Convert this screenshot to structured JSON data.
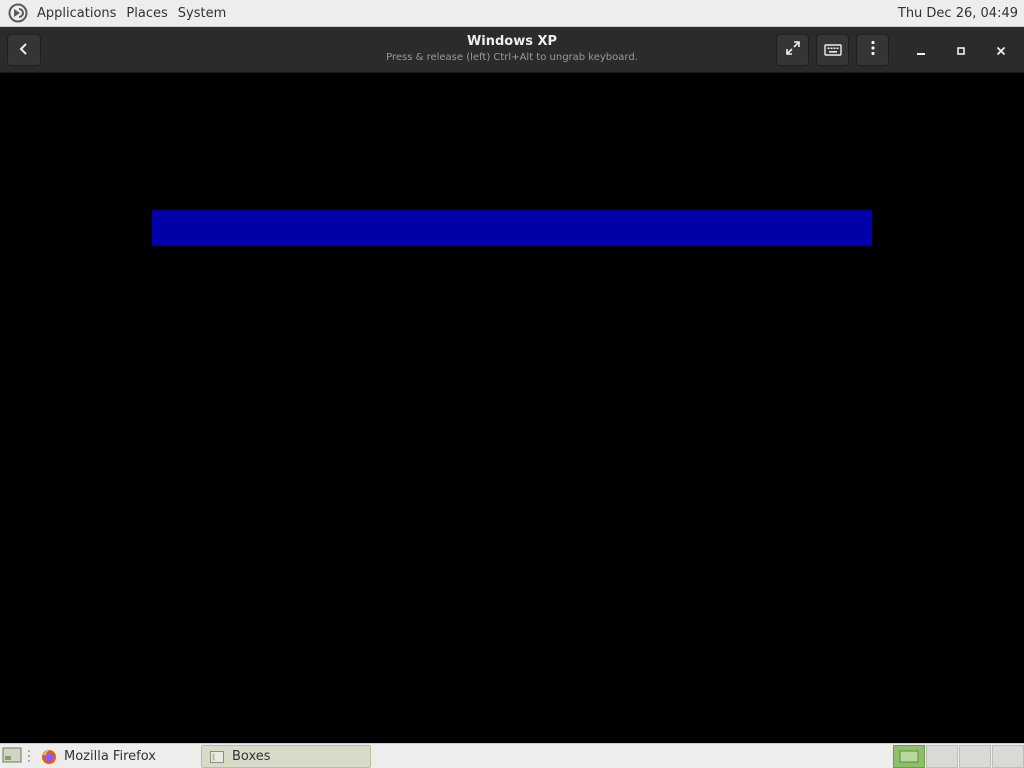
{
  "top_panel": {
    "menus": [
      "Applications",
      "Places",
      "System"
    ],
    "clock": "Thu Dec 26, 04:49",
    "logo_icon": "distro-logo-icon"
  },
  "headerbar": {
    "title": "Windows XP",
    "subtitle": "Press & release (left) Ctrl+Alt to ungrab keyboard.",
    "icons": {
      "back": "chevron-left-icon",
      "fullscreen": "fullscreen-icon",
      "keyboard": "keyboard-icon",
      "menu": "kebab-menu-icon",
      "minimize": "minimize-icon",
      "maximize": "maximize-icon",
      "close": "close-icon"
    }
  },
  "vm_display": {
    "bar_color": "#0000a8",
    "background": "#000000"
  },
  "bottom_panel": {
    "tasks": [
      {
        "label": "Mozilla Firefox",
        "icon": "firefox-icon",
        "active": false
      },
      {
        "label": "Boxes",
        "icon": "boxes-icon",
        "active": true
      }
    ],
    "workspaces": 4,
    "active_workspace": 1
  },
  "colors": {
    "panel_bg": "#ededeb",
    "headerbar_bg": "#2b2b2b",
    "accent": "#8fbf6a"
  }
}
